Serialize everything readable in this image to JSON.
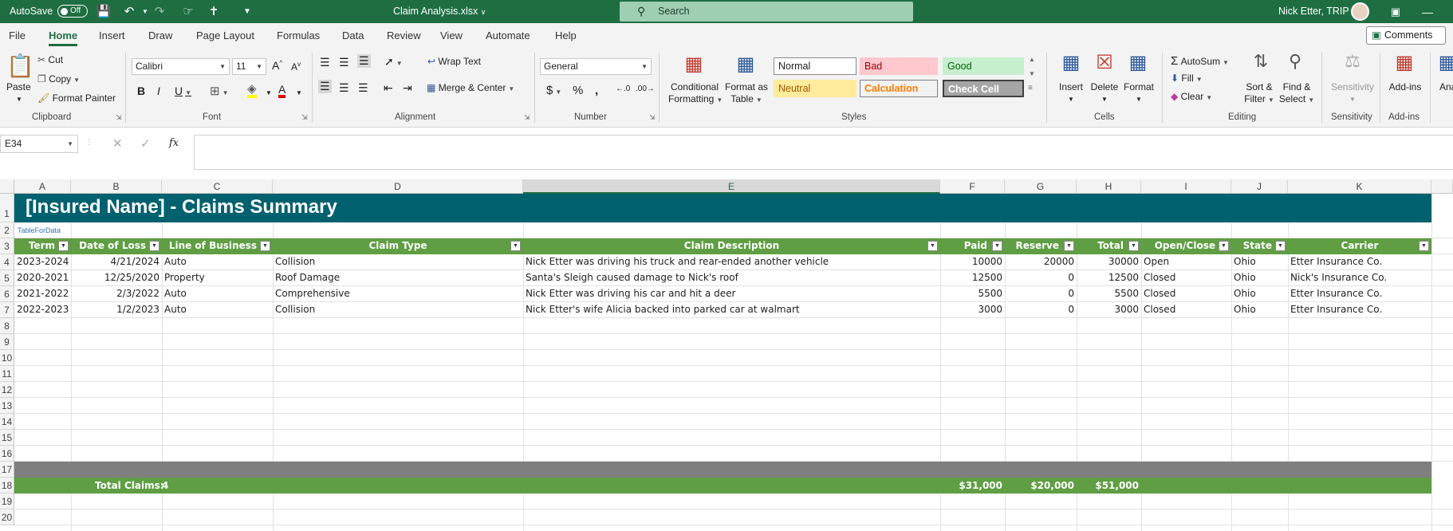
{
  "titlebar": {
    "autosave_label": "AutoSave",
    "autosave_state": "Off",
    "file_name": "Claim Analysis.xlsx",
    "search_placeholder": "Search",
    "user_name": "Nick Etter, TRIP"
  },
  "menu": {
    "tabs": [
      "File",
      "Home",
      "Insert",
      "Draw",
      "Page Layout",
      "Formulas",
      "Data",
      "Review",
      "View",
      "Automate",
      "Help"
    ],
    "active": "Home",
    "comments_label": "Comments"
  },
  "ribbon": {
    "clipboard": {
      "paste": "Paste",
      "cut": "Cut",
      "copy": "Copy",
      "format_painter": "Format Painter",
      "label": "Clipboard"
    },
    "font": {
      "name": "Calibri",
      "size": "11",
      "label": "Font"
    },
    "alignment": {
      "wrap_text": "Wrap Text",
      "merge_center": "Merge & Center",
      "label": "Alignment"
    },
    "number": {
      "format": "General",
      "label": "Number"
    },
    "styles": {
      "conditional_formatting": [
        "Conditional",
        "Formatting"
      ],
      "format_as_table": [
        "Format as",
        "Table"
      ],
      "normal": "Normal",
      "bad": "Bad",
      "good": "Good",
      "neutral": "Neutral",
      "calculation": "Calculation",
      "check_cell": "Check Cell",
      "label": "Styles"
    },
    "cells": {
      "insert": "Insert",
      "delete": "Delete",
      "format": "Format",
      "label": "Cells"
    },
    "editing": {
      "autosum": "AutoSum",
      "fill": "Fill",
      "clear": "Clear",
      "sort_filter": [
        "Sort &",
        "Filter"
      ],
      "find_select": [
        "Find &",
        "Select"
      ],
      "label": "Editing"
    },
    "sensitivity": {
      "button": "Sensitivity",
      "label": "Sensitivity"
    },
    "addins": {
      "button": "Add-ins",
      "label": "Add-ins",
      "partial": "Ana"
    },
    "colors": {
      "bad_bg": "#ffc7ce",
      "bad_fg": "#9c0006",
      "good_bg": "#c6efce",
      "good_fg": "#006100",
      "neutral_bg": "#ffeb9c",
      "neutral_fg": "#9c5700",
      "calc_fg": "#fa7d00",
      "check_bg": "#a5a5a5"
    }
  },
  "formula_bar": {
    "name_box": "E34",
    "fx": "fx",
    "content": ""
  },
  "sheet": {
    "columns": [
      "A",
      "B",
      "C",
      "D",
      "E",
      "F",
      "G",
      "H",
      "I",
      "J",
      "K"
    ],
    "selected_column": "E",
    "row_numbers": [
      "1",
      "2",
      "3",
      "4",
      "5",
      "6",
      "7",
      "8",
      "9",
      "10",
      "11",
      "12",
      "13",
      "14",
      "15",
      "16",
      "17",
      "18",
      "19",
      "20"
    ],
    "title": "[Insured Name] - Claims Summary",
    "table_name_label": "TableForData",
    "headers": [
      "Term",
      "Date of Loss",
      "Line of Business",
      "Claim Type",
      "Claim Description",
      "Paid",
      "Reserve",
      "Total",
      "Open/Close",
      "State",
      "Carrier"
    ],
    "rows": [
      [
        "2023-2024",
        "4/21/2024",
        "Auto",
        "Collision",
        "Nick Etter was driving his truck and rear-ended another vehicle",
        "10000",
        "20000",
        "30000",
        "Open",
        "Ohio",
        "Etter Insurance Co."
      ],
      [
        "2020-2021",
        "12/25/2020",
        "Property",
        "Roof Damage",
        "Santa's Sleigh caused damage to Nick's roof",
        "12500",
        "0",
        "12500",
        "Closed",
        "Ohio",
        "Nick's Insurance Co."
      ],
      [
        "2021-2022",
        "2/3/2022",
        "Auto",
        "Comprehensive",
        "Nick Etter was driving his car and hit a deer",
        "5500",
        "0",
        "5500",
        "Closed",
        "Ohio",
        "Etter Insurance Co."
      ],
      [
        "2022-2023",
        "1/2/2023",
        "Auto",
        "Collision",
        "Nick Etter's wife Alicia backed into parked car at walmart",
        "3000",
        "0",
        "3000",
        "Closed",
        "Ohio",
        "Etter Insurance Co."
      ]
    ],
    "totals": {
      "label": "Total Claims:",
      "count": "4",
      "paid": "$31,000",
      "reserve": "$20,000",
      "total": "$51,000"
    },
    "colors": {
      "title_bg": "#02616e",
      "header_bg": "#5f9e43",
      "divider_bg": "#7f7f7f",
      "totals_bg": "#5f9e43",
      "accent": "#1e6e42"
    }
  }
}
